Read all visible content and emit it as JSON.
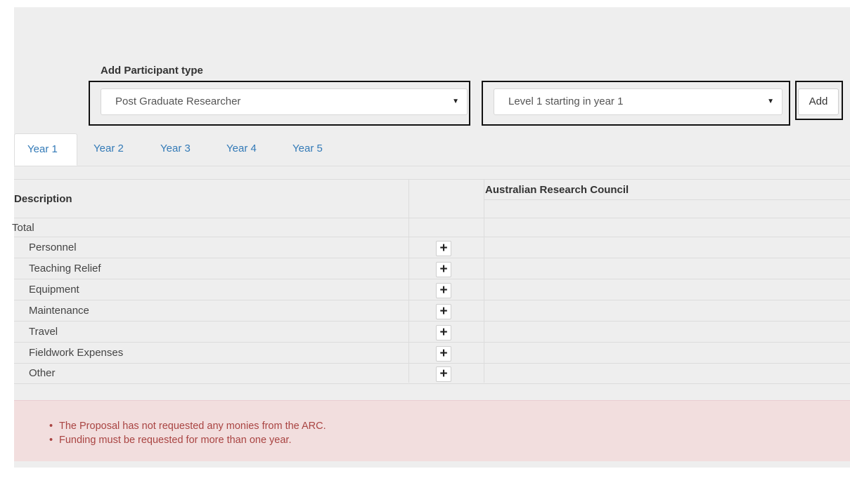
{
  "form": {
    "participant_label": "Add Participant type",
    "participant_type": "Post Graduate Researcher",
    "level": "Level 1 starting in year 1",
    "add_label": "Add"
  },
  "tabs": [
    {
      "label": "Year 1",
      "active": true
    },
    {
      "label": "Year 2",
      "active": false
    },
    {
      "label": "Year 3",
      "active": false
    },
    {
      "label": "Year 4",
      "active": false
    },
    {
      "label": "Year 5",
      "active": false
    }
  ],
  "table": {
    "description_header": "Description",
    "funder_header": "Australian Research Council",
    "total_label": "Total",
    "rows": [
      {
        "label": "Personnel"
      },
      {
        "label": "Teaching Relief"
      },
      {
        "label": "Equipment"
      },
      {
        "label": "Maintenance"
      },
      {
        "label": "Travel"
      },
      {
        "label": "Fieldwork Expenses"
      },
      {
        "label": "Other"
      }
    ]
  },
  "alerts": [
    "The Proposal has not requested any monies from the ARC.",
    "Funding must be requested for more than one year."
  ],
  "colors": {
    "panel_bg": "#eeeeee",
    "link": "#337ab7",
    "alert_bg": "#f2dede",
    "alert_text": "#a94442"
  },
  "icons": {
    "dropdown": "caret-down-icon",
    "add_row": "plus-icon",
    "bullet": "bullet-icon"
  }
}
